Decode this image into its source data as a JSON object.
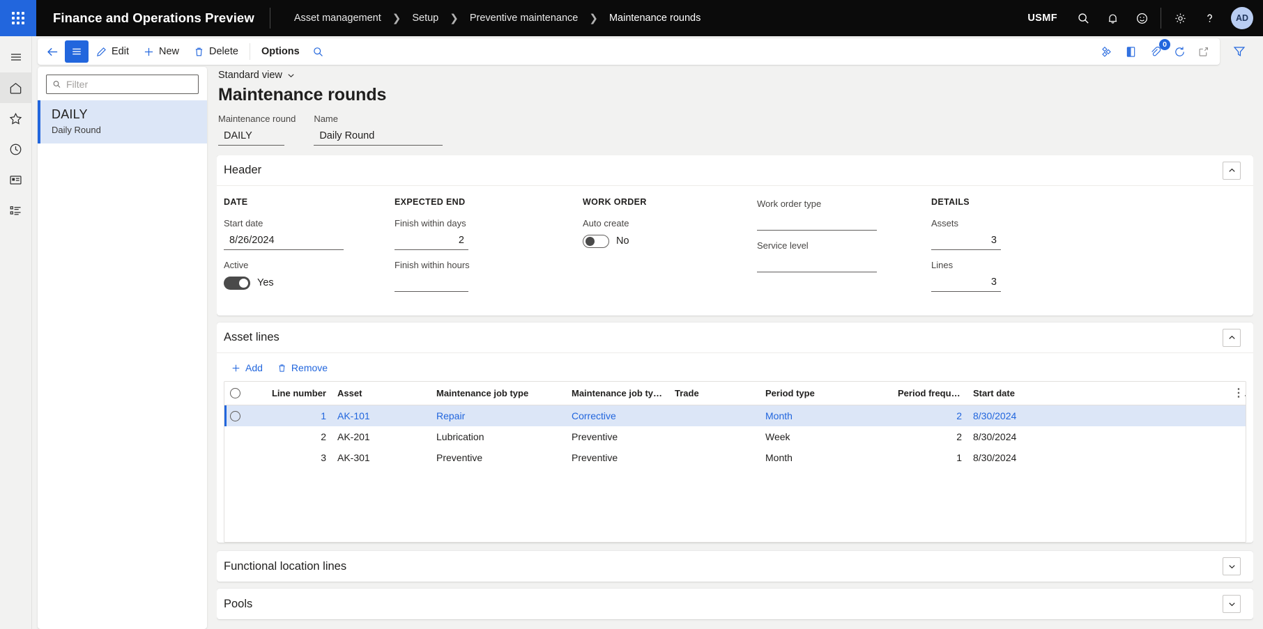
{
  "topnav": {
    "waffle_label": "app-launcher",
    "app_title": "Finance and Operations Preview",
    "breadcrumbs": [
      "Asset management",
      "Setup",
      "Preventive maintenance",
      "Maintenance rounds"
    ],
    "company": "USMF",
    "icons": [
      "search-icon",
      "notifications-icon",
      "feedback-icon",
      "settings-icon",
      "help-icon"
    ],
    "avatar_initials": "AD"
  },
  "rail": {
    "items": [
      "hamburger-menu-icon",
      "home-icon",
      "favorites-star-icon",
      "recent-clock-icon",
      "workspaces-icon",
      "modules-list-icon"
    ]
  },
  "actionbar": {
    "back_label": "back-arrow-icon",
    "menu_label": "show-hide-navigation",
    "edit": "Edit",
    "new": "New",
    "delete": "Delete",
    "options": "Options",
    "search_label": "search-icon",
    "right_icons": [
      "power-automate-icon",
      "office-apps-icon",
      "attachments-icon",
      "refresh-icon",
      "open-in-new-window-icon"
    ],
    "attachment_badge": "0",
    "filter_label": "filter-funnel-icon"
  },
  "listpane": {
    "filter_placeholder": "Filter",
    "filter_value": "",
    "items": [
      {
        "title": "DAILY",
        "subtitle": "Daily Round",
        "selected": true
      }
    ]
  },
  "page": {
    "view_selector": "Standard view",
    "title": "Maintenance rounds",
    "fields": [
      {
        "label": "Maintenance round",
        "value": "DAILY"
      },
      {
        "label": "Name",
        "value": "Daily Round"
      }
    ]
  },
  "header_section": {
    "title": "Header",
    "groups": [
      {
        "name": "DATE",
        "fields": [
          {
            "label": "Start date",
            "value": "8/26/2024",
            "type": "text"
          },
          {
            "label": "Active",
            "value": "Yes",
            "type": "toggle",
            "on": true
          }
        ]
      },
      {
        "name": "EXPECTED END",
        "fields": [
          {
            "label": "Finish within days",
            "value": "2",
            "type": "number"
          },
          {
            "label": "Finish within hours",
            "value": "",
            "type": "number"
          }
        ]
      },
      {
        "name": "WORK ORDER",
        "fields": [
          {
            "label": "Auto create",
            "value": "No",
            "type": "toggle",
            "on": false
          }
        ]
      },
      {
        "name": "",
        "fields": [
          {
            "label": "Work order type",
            "value": "",
            "type": "text"
          },
          {
            "label": "Service level",
            "value": "",
            "type": "text"
          }
        ]
      },
      {
        "name": "DETAILS",
        "fields": [
          {
            "label": "Assets",
            "value": "3",
            "type": "number"
          },
          {
            "label": "Lines",
            "value": "3",
            "type": "number"
          }
        ]
      }
    ]
  },
  "asset_lines": {
    "title": "Asset lines",
    "toolbar": {
      "add": "Add",
      "remove": "Remove"
    },
    "columns": [
      "Line number",
      "Asset",
      "Maintenance job type",
      "Maintenance job type vari...",
      "Trade",
      "Period type",
      "Period frequen...",
      "Start date"
    ],
    "rows": [
      {
        "line_number": "1",
        "asset": "AK-101",
        "job_type": "Repair",
        "job_type_variant": "Corrective",
        "trade": "",
        "period_type": "Month",
        "period_frequency": "2",
        "start_date": "8/30/2024",
        "selected": true
      },
      {
        "line_number": "2",
        "asset": "AK-201",
        "job_type": "Lubrication",
        "job_type_variant": "Preventive",
        "trade": "",
        "period_type": "Week",
        "period_frequency": "2",
        "start_date": "8/30/2024",
        "selected": false
      },
      {
        "line_number": "3",
        "asset": "AK-301",
        "job_type": "Preventive",
        "job_type_variant": "Preventive",
        "trade": "",
        "period_type": "Month",
        "period_frequency": "1",
        "start_date": "8/30/2024",
        "selected": false
      }
    ]
  },
  "collapsed_sections": [
    {
      "title": "Functional location lines"
    },
    {
      "title": "Pools"
    }
  ],
  "colors": {
    "accent": "#2266dd",
    "selection": "#dce6f7",
    "topbar": "#0b0b0b",
    "page_bg": "#f2f2f1"
  }
}
